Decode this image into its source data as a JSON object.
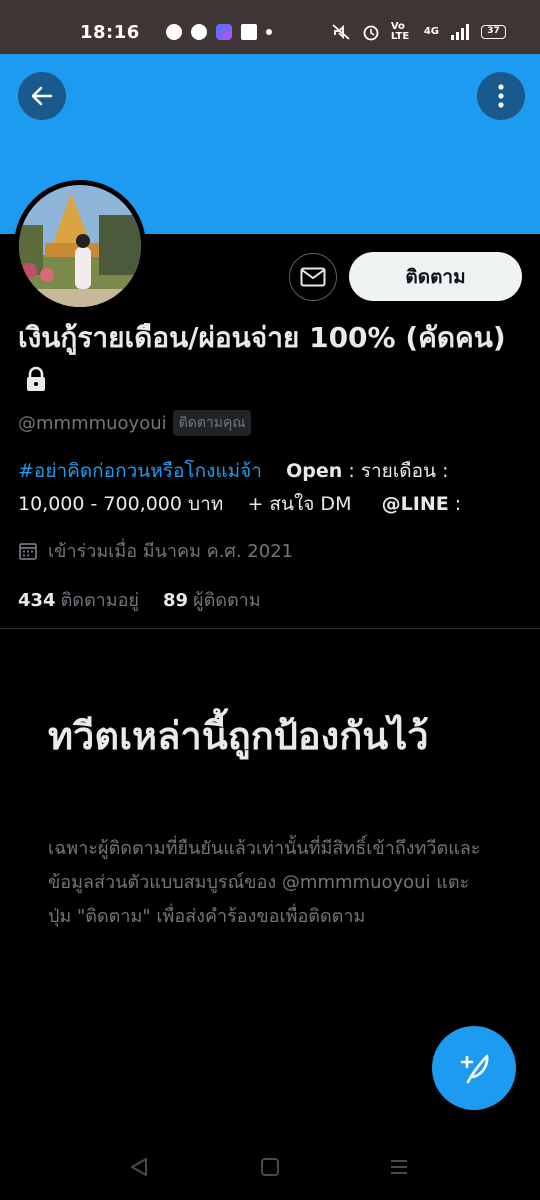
{
  "status_bar": {
    "time": "18:16",
    "volte": "Vo LTE",
    "network": "4G",
    "battery": "37",
    "icons": [
      "line-icon",
      "messenger-icon",
      "app-icon",
      "facebook-icon",
      "dot-icon",
      "mute-icon",
      "alarm-icon",
      "signal-icon"
    ]
  },
  "header": {
    "back_icon": "arrow-left-icon",
    "more_icon": "more-vertical-icon",
    "banner_color": "#1d9bf0"
  },
  "profile": {
    "name": "เงินกู้รายเดือน/ผ่อนจ่าย 100% (คัดคน)",
    "handle": "@mmmmuoyoui",
    "follows_you": "ติดตามคุณ",
    "follow_button": "ติดตาม",
    "bio": {
      "hashtag": "#อย่าคิดก่อกวนหรือโกงแม่จ้า",
      "open_label": "Open",
      "line1_rest": " : รายเดือน :",
      "line2": "10,000 - 700,000 บาท    + สนใจ DM     ",
      "line_label": "@LINE",
      "line2_end": " :"
    },
    "joined": "เข้าร่วมเมื่อ มีนาคม ค.ศ. 2021",
    "following_count": "434",
    "following_label": "ติดตามอยู่",
    "followers_count": "89",
    "followers_label": "ผู้ติดตาม"
  },
  "protected": {
    "title": "ทวีตเหล่านี้ถูกป้องกันไว้",
    "description": "เฉพาะผู้ติดตามที่ยืนยันแล้วเท่านั้นที่มีสิทธิ์เข้าถึงทวีตและข้อมูลส่วนตัวแบบสมบูรณ์ของ @mmmmuoyoui แตะปุ่ม \"ติดตาม\" เพื่อส่งคำร้องขอเพื่อติดตาม"
  },
  "fab": {
    "icon": "compose-tweet-icon"
  },
  "nav": {
    "icons": [
      "nav-back-icon",
      "nav-home-icon",
      "nav-recents-icon"
    ]
  },
  "colors": {
    "accent": "#1d9bf0",
    "background": "#000000",
    "secondary_text": "#71767b"
  }
}
